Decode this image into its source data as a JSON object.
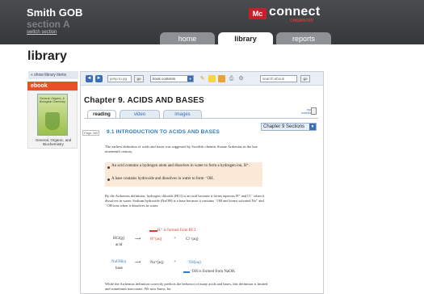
{
  "header": {
    "course_title": "Smith GOB",
    "section": "section A",
    "switch_section": "switch section",
    "brand_logo": "Mc",
    "brand_name": "connect",
    "brand_sub": "CHEMISTRY",
    "tabs": [
      {
        "label": "home",
        "active": false
      },
      {
        "label": "library",
        "active": true
      },
      {
        "label": "reports",
        "active": false
      }
    ]
  },
  "page_title": "library",
  "sidebar": {
    "show_items": "« show library items",
    "ebook_tab": "ebook",
    "cover_title": "General, Organic, & Biological Chemistry",
    "ebook_caption": "General, Organic, and Biochemistry"
  },
  "toolbar": {
    "prev": "◄",
    "next": "►",
    "jump_placeholder": "jump to pg",
    "go": "go",
    "book_contents": "book contents",
    "search_placeholder": "search ebook",
    "search_go": "go"
  },
  "reader": {
    "chapter_title": "Chapter 9.  ACIDS AND BASES",
    "my_notebook": "my notebook",
    "subtabs": [
      {
        "label": "reading",
        "active": true
      },
      {
        "label": "video",
        "active": false
      },
      {
        "label": "images",
        "active": false
      }
    ],
    "sections_select": "Chapter 9 Sections",
    "page_number": "Page 260",
    "section_heading": "9.1  INTRODUCTION TO ACIDS AND BASES",
    "intro_text": "The earliest definition of acids and bases was suggested by Swedish chemist Svante Arrhenius in the late nineteenth century.",
    "definitions": [
      "An acid contains a hydrogen atom and dissolves in water to form a hydrogen ion, H⁺.",
      "A base contains hydroxide and dissolves in water to form ⁻OH."
    ],
    "para_text": "By the Arrhenius definition, hydrogen chloride (HCl) is an acid because it forms aqueous H⁺ and Cl⁻ when it dissolves in water. Sodium hydroxide (NaOH) is a base because it contains ⁻OH and forms solvated Na⁺ and ⁻OH ions when it dissolves in water.",
    "eq1": {
      "callout": "H⁺ is formed from HCl.",
      "reactant": "HCl(g)",
      "reactant_label": "acid",
      "arrow": "⟶",
      "product1": "H⁺(aq)",
      "plus": "+",
      "product2": "Cl⁻(aq)"
    },
    "eq2": {
      "reactant": "NaOH(s)",
      "reactant_label": "base",
      "arrow": "⟶",
      "product1": "Na⁺(aq)",
      "plus": "+",
      "product2": "⁻OH(aq)",
      "callout": "⁻OH is formed from NaOH."
    },
    "closing_text": "While the Arrhenius definition correctly predicts the behavior of many acids and bases, this definition is limited and sometimes inaccurate. We now know, for"
  },
  "colors": {
    "header_bg": "#3e4044",
    "accent_orange": "#e8502a",
    "link_blue": "#2f7bbd",
    "definition_bg": "#fbe9d8",
    "callout_red": "#d6402e"
  }
}
